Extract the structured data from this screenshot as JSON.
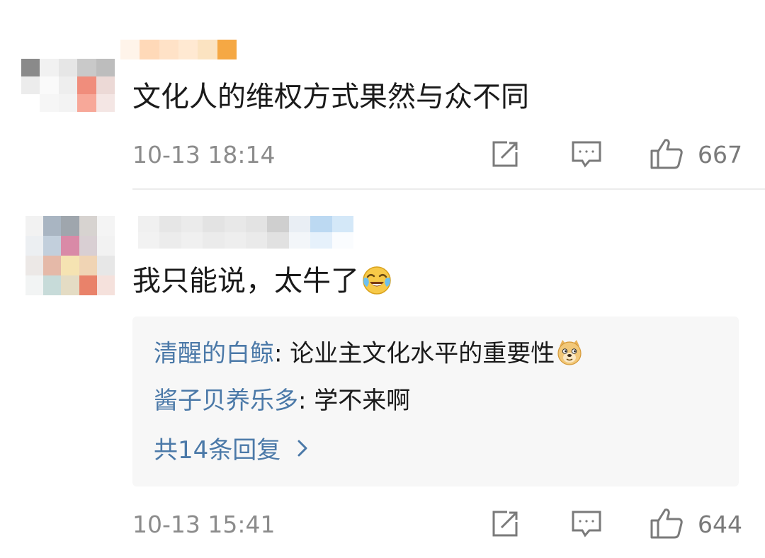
{
  "comments": [
    {
      "text": "文化人的维权方式果然与众不同",
      "time": "10-13 18:14",
      "likes": "667",
      "icons": [
        "share-icon",
        "comment-icon",
        "like-icon"
      ]
    },
    {
      "text": "我只能说，太牛了",
      "emoji": "laughing-tears-emoji",
      "time": "10-13 15:41",
      "likes": "644",
      "icons": [
        "share-icon",
        "comment-icon",
        "like-icon"
      ],
      "replies": [
        {
          "author": "清醒的白鲸",
          "sep": ": ",
          "text": "论业主文化水平的重要性",
          "emoji": "doge-emoji"
        },
        {
          "author": "酱子贝养乐多",
          "sep": ": ",
          "text": "学不来啊"
        }
      ],
      "more_replies": "共14条回复"
    }
  ],
  "colors": {
    "link": "#4b79a8",
    "meta": "#8c8c8c",
    "text": "#1a1a1a",
    "reply_bg": "#f7f7f7"
  }
}
